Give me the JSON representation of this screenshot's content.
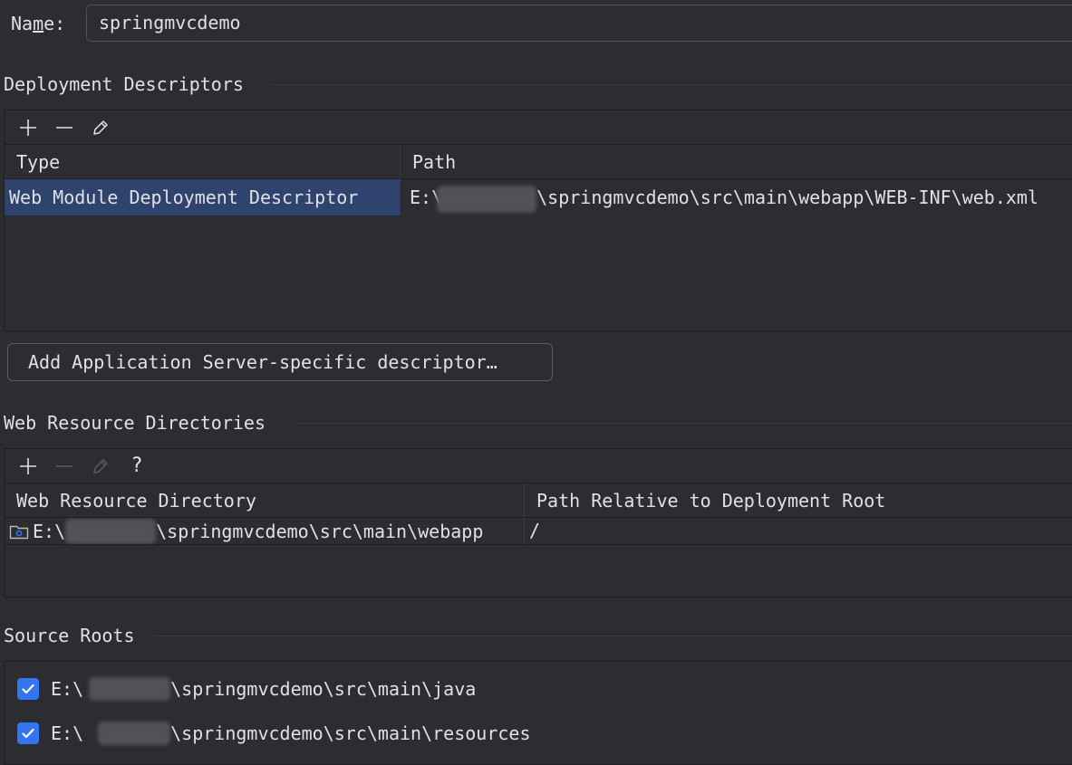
{
  "name_field": {
    "label_prefix": "Na",
    "label_mnemonic": "m",
    "label_suffix": "e:",
    "value": "springmvcdemo"
  },
  "deployment_descriptors": {
    "title": "Deployment Descriptors",
    "toolbar": [
      "add-icon",
      "remove-icon",
      "edit-icon"
    ],
    "columns": [
      "Type",
      "Path"
    ],
    "rows": [
      {
        "type": "Web Module Deployment Descriptor",
        "path_prefix": "E:\\",
        "path_suffix": "\\springmvcdemo\\src\\main\\webapp\\WEB-INF\\web.xml",
        "selected": true
      }
    ],
    "add_button_label": "Add Application Server-specific descriptor…"
  },
  "web_resource_directories": {
    "title": "Web Resource Directories",
    "toolbar": [
      "add-icon",
      "remove-icon",
      "edit-icon",
      "help-icon"
    ],
    "help_label": "?",
    "columns": [
      "Web Resource Directory",
      "Path Relative to Deployment Root"
    ],
    "rows": [
      {
        "directory_prefix": "E:\\",
        "directory_suffix": "\\springmvcdemo\\src\\main\\webapp",
        "relative_path": "/"
      }
    ]
  },
  "source_roots": {
    "title": "Source Roots",
    "items": [
      {
        "prefix": "E:\\",
        "suffix": "\\springmvcdemo\\src\\main\\java",
        "checked": true
      },
      {
        "prefix": "E:\\",
        "suffix": "\\springmvcdemo\\src\\main\\resources",
        "checked": true
      }
    ]
  },
  "colors": {
    "background": "#2b2d30",
    "selection": "#2e436e",
    "accent": "#3574f0",
    "text": "#dfe1e5"
  }
}
